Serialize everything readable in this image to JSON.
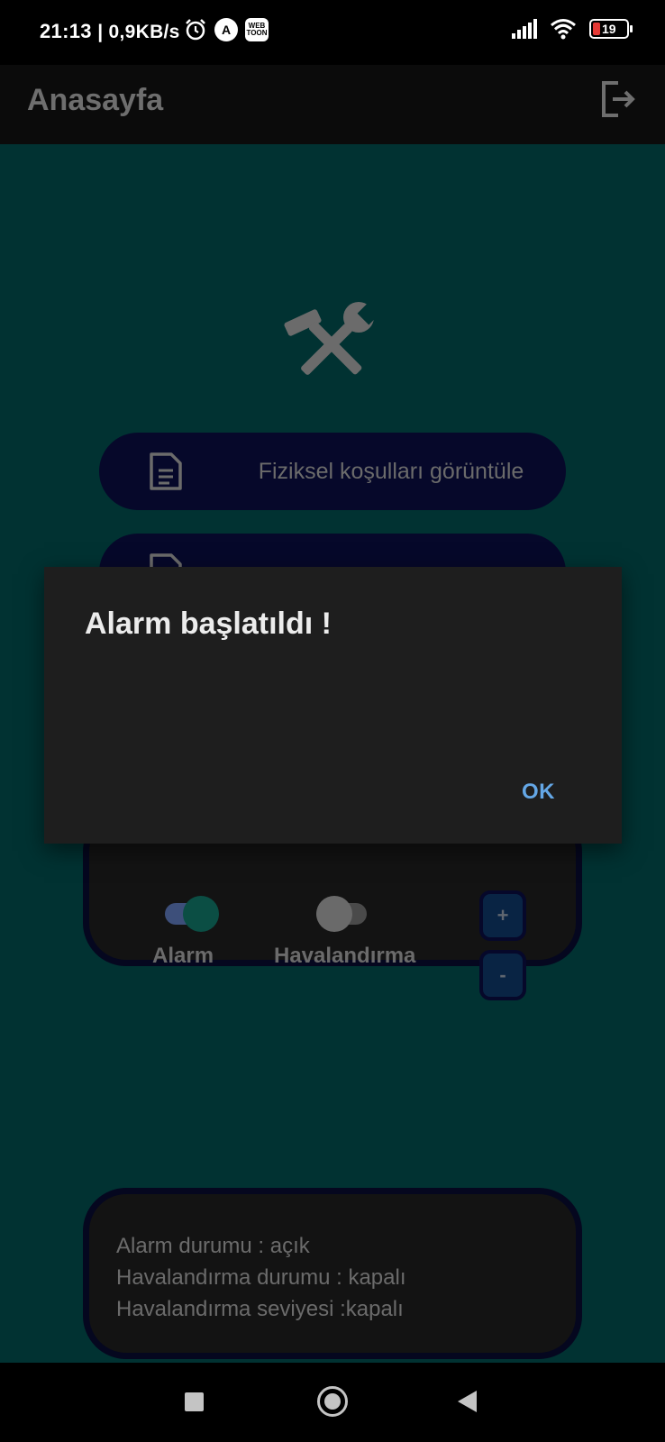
{
  "status_bar": {
    "time": "21:13",
    "speed": "| 0,9KB/s",
    "battery_level": "19",
    "icons": [
      "alarm-clock-icon",
      "app-a-icon",
      "webtoon-icon",
      "signal-icon",
      "wifi-icon",
      "battery-icon"
    ],
    "webtoon_label": "WEB TOON"
  },
  "app_bar": {
    "title": "Anasayfa",
    "action_icon": "logout-icon"
  },
  "main": {
    "header_icon": "tools-icon",
    "buttons": [
      {
        "label": "Fiziksel koşulları görüntüle",
        "icon": "document-icon"
      },
      {
        "label": "",
        "icon": "document-icon"
      }
    ],
    "controls": {
      "alarm_label": "Alarm",
      "alarm_on": true,
      "vent_label": "Havalandırma",
      "vent_on": false,
      "plus_label": "+",
      "minus_label": "-"
    },
    "status": {
      "lines": [
        "Alarm durumu : açık",
        "Havalandırma durumu : kapalı",
        "Havalandırma seviyesi :kapalı"
      ]
    }
  },
  "dialog": {
    "title": "Alarm başlatıldı !",
    "ok_label": "OK"
  },
  "colors": {
    "background": "#013232",
    "button": "#06082a",
    "dialog": "#1e1e1e",
    "accent": "#64a7e6"
  }
}
